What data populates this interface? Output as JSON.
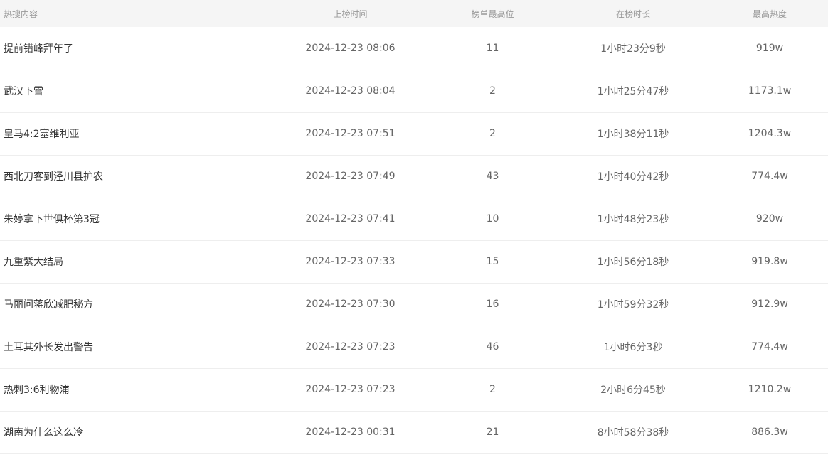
{
  "table": {
    "headers": [
      "热搜内容",
      "上榜时间",
      "榜单最高位",
      "在榜时长",
      "最高热度"
    ],
    "rows": [
      {
        "title": "提前错峰拜年了",
        "time": "2024-12-23 08:06",
        "rank": "11",
        "duration": "1小时23分9秒",
        "heat": "919w"
      },
      {
        "title": "武汉下雪",
        "time": "2024-12-23 08:04",
        "rank": "2",
        "duration": "1小时25分47秒",
        "heat": "1173.1w"
      },
      {
        "title": "皇马4:2塞维利亚",
        "time": "2024-12-23 07:51",
        "rank": "2",
        "duration": "1小时38分11秒",
        "heat": "1204.3w"
      },
      {
        "title": "西北刀客到泾川县护农",
        "time": "2024-12-23 07:49",
        "rank": "43",
        "duration": "1小时40分42秒",
        "heat": "774.4w"
      },
      {
        "title": "朱婷拿下世俱杯第3冠",
        "time": "2024-12-23 07:41",
        "rank": "10",
        "duration": "1小时48分23秒",
        "heat": "920w"
      },
      {
        "title": "九重紫大结局",
        "time": "2024-12-23 07:33",
        "rank": "15",
        "duration": "1小时56分18秒",
        "heat": "919.8w"
      },
      {
        "title": "马丽问蒋欣减肥秘方",
        "time": "2024-12-23 07:30",
        "rank": "16",
        "duration": "1小时59分32秒",
        "heat": "912.9w"
      },
      {
        "title": "土耳其外长发出警告",
        "time": "2024-12-23 07:23",
        "rank": "46",
        "duration": "1小时6分3秒",
        "heat": "774.4w"
      },
      {
        "title": "热刺3:6利物浦",
        "time": "2024-12-23 07:23",
        "rank": "2",
        "duration": "2小时6分45秒",
        "heat": "1210.2w"
      },
      {
        "title": "湖南为什么这么冷",
        "time": "2024-12-23 00:31",
        "rank": "21",
        "duration": "8小时58分38秒",
        "heat": "886.3w"
      }
    ]
  }
}
